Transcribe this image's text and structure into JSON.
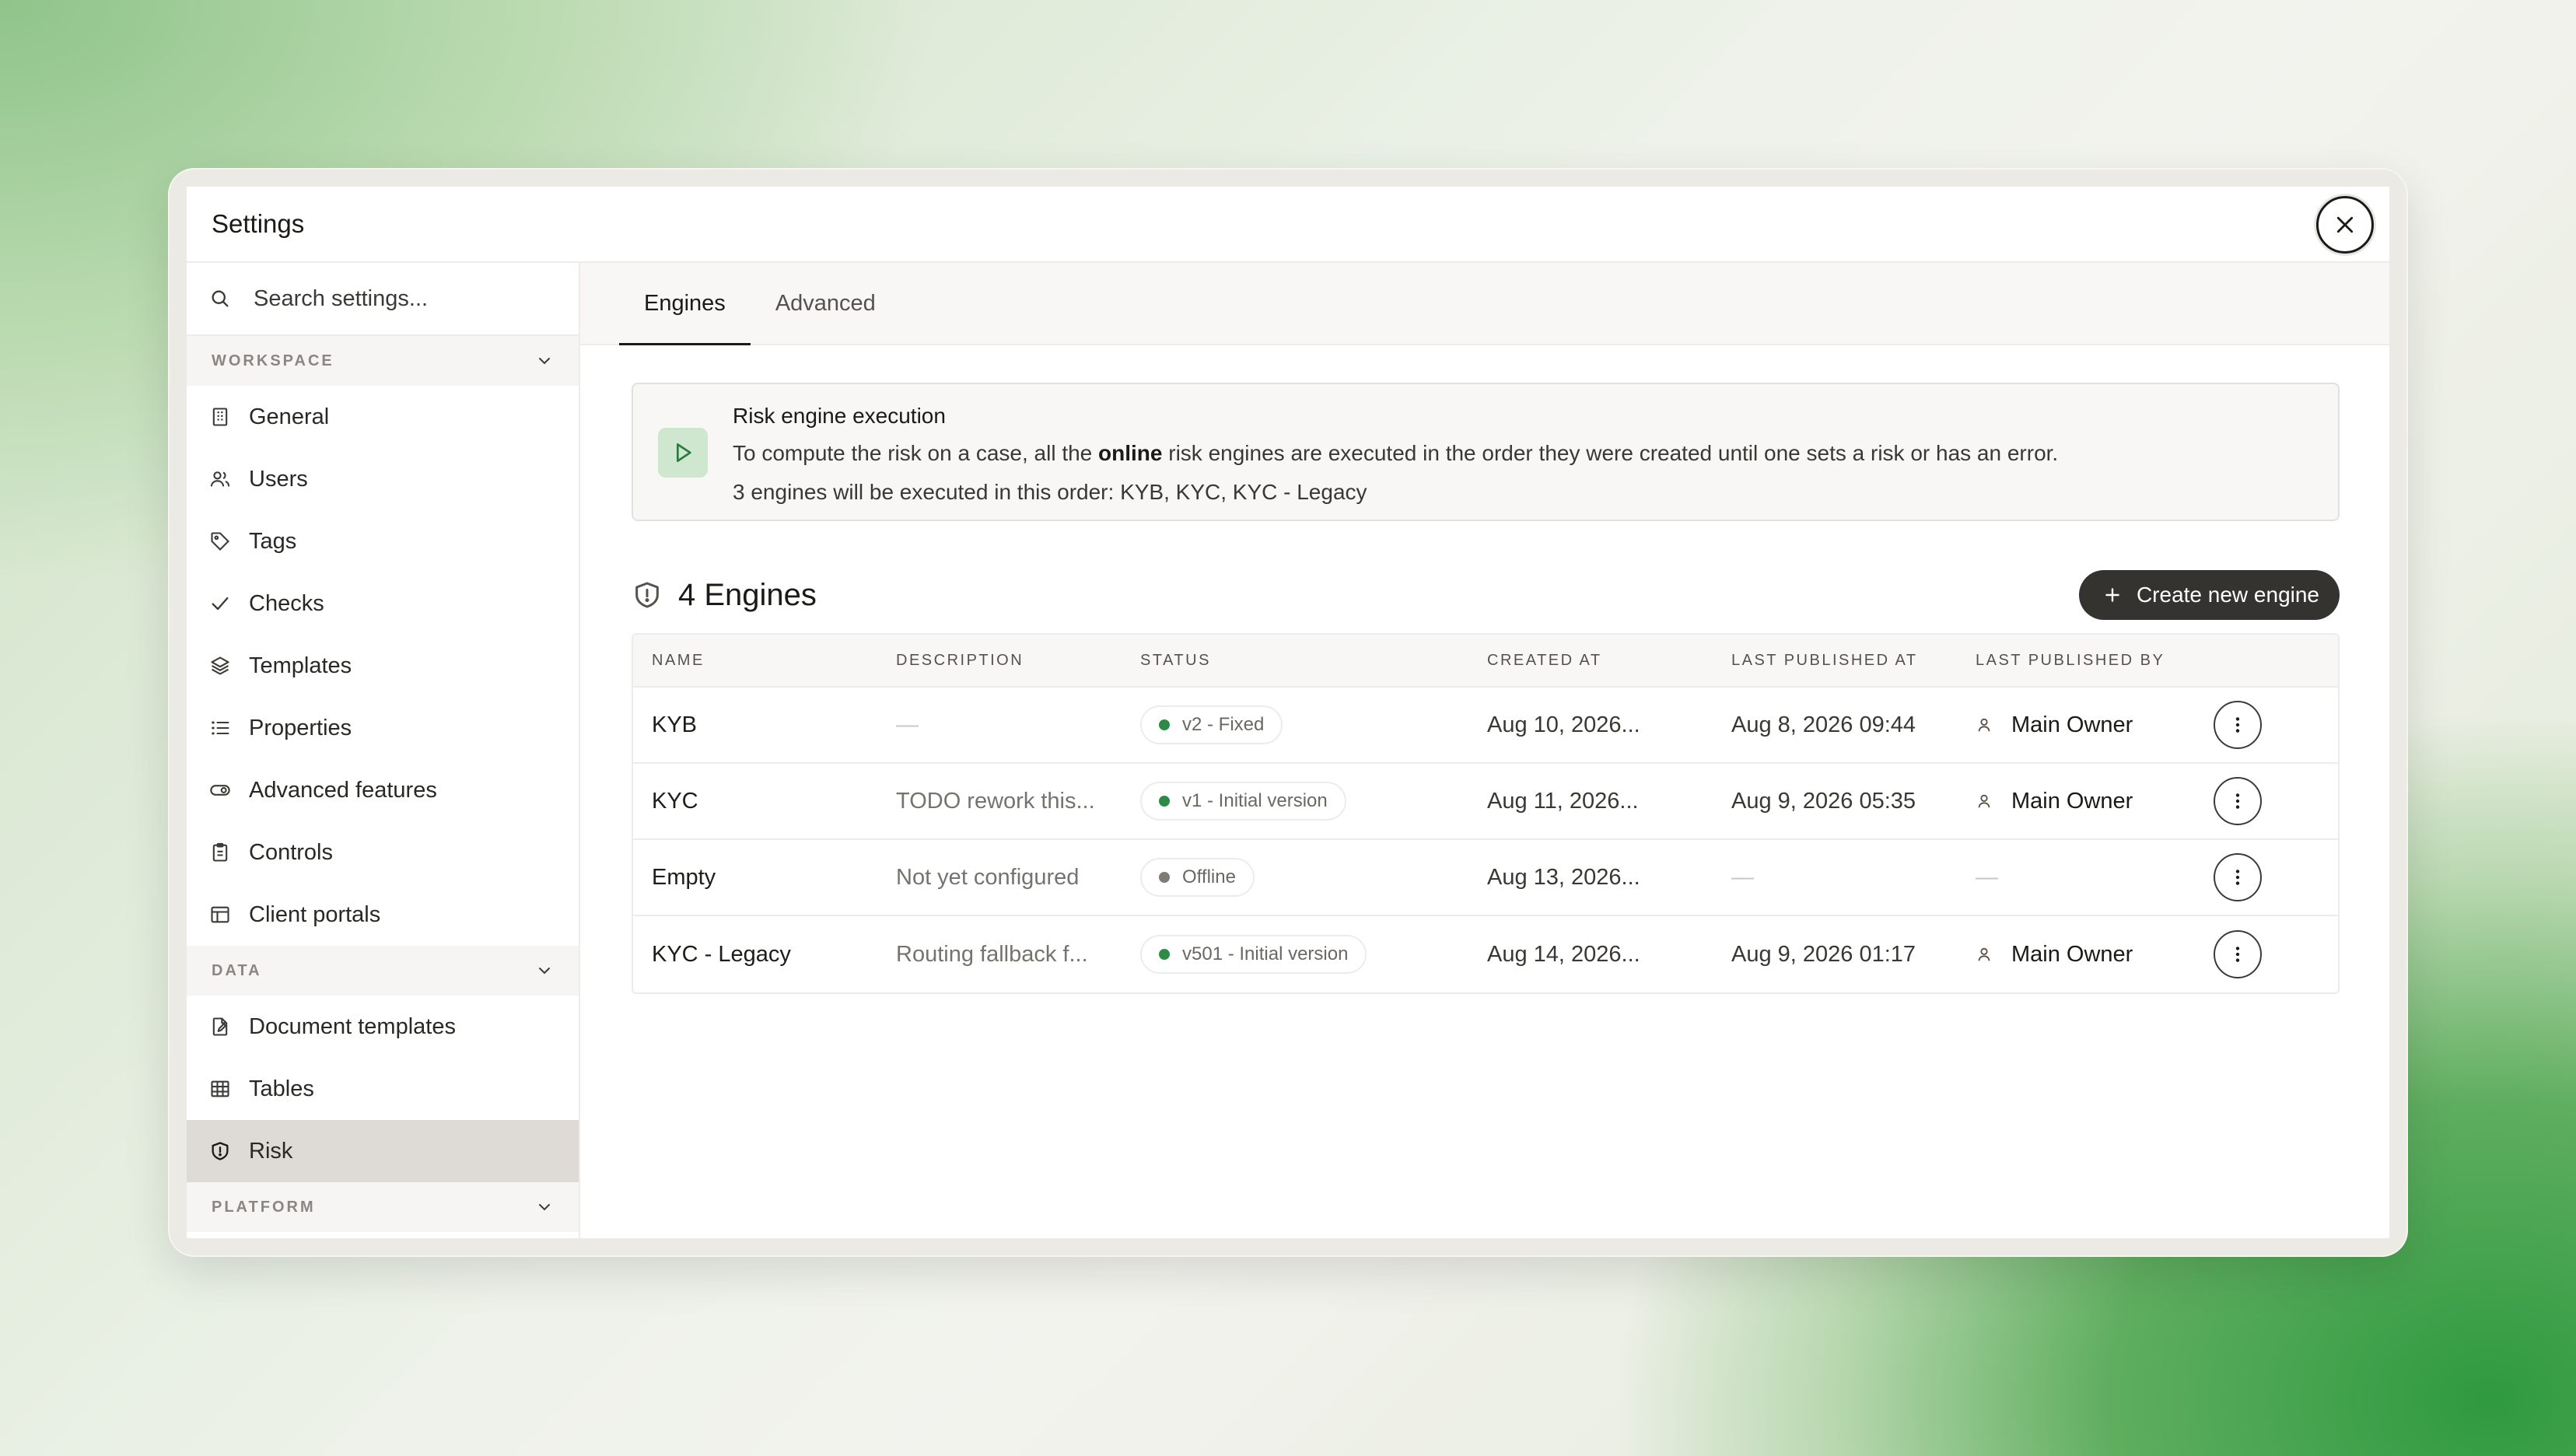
{
  "window": {
    "title": "Settings"
  },
  "sidebar": {
    "search_placeholder": "Search settings...",
    "sections": {
      "workspace": "WORKSPACE",
      "data": "DATA",
      "platform": "PLATFORM"
    },
    "workspace_items": [
      {
        "label": "General",
        "icon": "building-icon"
      },
      {
        "label": "Users",
        "icon": "users-icon"
      },
      {
        "label": "Tags",
        "icon": "tag-icon"
      },
      {
        "label": "Checks",
        "icon": "check-icon"
      },
      {
        "label": "Templates",
        "icon": "layers-icon"
      },
      {
        "label": "Properties",
        "icon": "list-icon"
      },
      {
        "label": "Advanced features",
        "icon": "toggle-icon"
      },
      {
        "label": "Controls",
        "icon": "clipboard-icon"
      },
      {
        "label": "Client portals",
        "icon": "layout-icon"
      }
    ],
    "data_items": [
      {
        "label": "Document templates",
        "icon": "file-edit-icon"
      },
      {
        "label": "Tables",
        "icon": "table-icon"
      },
      {
        "label": "Risk",
        "icon": "shield-icon",
        "active": true
      }
    ]
  },
  "tabs": [
    {
      "label": "Engines",
      "active": true
    },
    {
      "label": "Advanced",
      "active": false
    }
  ],
  "info": {
    "title": "Risk engine execution",
    "line1_before": "To compute the risk on a case, all the ",
    "line1_bold": "online",
    "line1_after": " risk engines are executed in the order they were created until one sets a risk or has an error.",
    "line2": "3 engines will be executed in this order: KYB, KYC, KYC - Legacy"
  },
  "engines": {
    "title": "4 Engines",
    "create_label": "Create new engine",
    "columns": [
      "NAME",
      "DESCRIPTION",
      "STATUS",
      "CREATED AT",
      "LAST PUBLISHED AT",
      "LAST PUBLISHED BY"
    ],
    "rows": [
      {
        "name": "KYB",
        "description": "—",
        "status": "v2 - Fixed",
        "status_color": "#2c8c45",
        "created": "Aug 10, 2026...",
        "published": "Aug 8, 2026 09:44",
        "published_by": "Main Owner"
      },
      {
        "name": "KYC",
        "description": "TODO rework this...",
        "status": "v1 - Initial version",
        "status_color": "#2c8c45",
        "created": "Aug 11, 2026...",
        "published": "Aug 9, 2026 05:35",
        "published_by": "Main Owner"
      },
      {
        "name": "Empty",
        "description": "Not yet configured",
        "status": "Offline",
        "status_color": "#7e7b76",
        "created": "Aug 13, 2026...",
        "published": "—",
        "published_by": "—"
      },
      {
        "name": "KYC - Legacy",
        "description": "Routing fallback f...",
        "status": "v501 - Initial version",
        "status_color": "#2c8c45",
        "created": "Aug 14, 2026...",
        "published": "Aug 9, 2026 01:17",
        "published_by": "Main Owner"
      }
    ]
  }
}
